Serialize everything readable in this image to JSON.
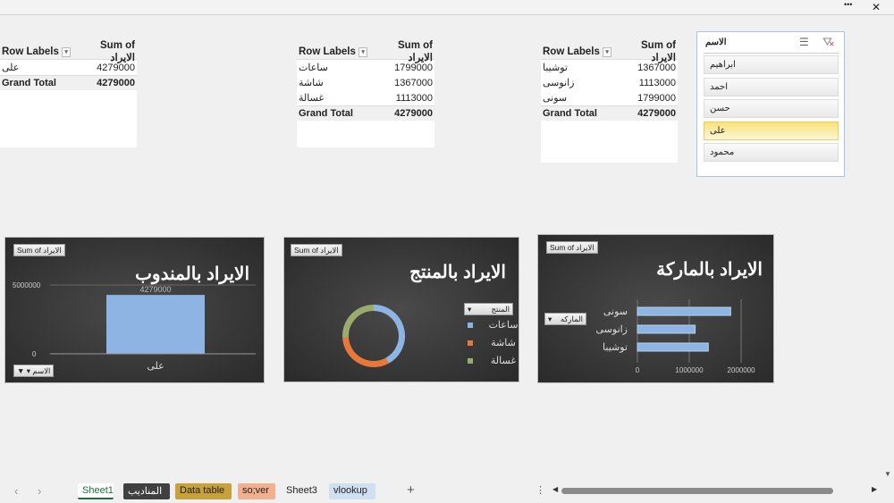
{
  "window": {
    "more_label": "•••",
    "close_label": "✕"
  },
  "pivot1": {
    "header_row": "Row Labels",
    "header_value": "Sum of الايراد",
    "rows": [
      {
        "label": "على",
        "value": "4279000"
      }
    ],
    "total_label": "Grand Total",
    "total_value": "4279000"
  },
  "pivot2": {
    "header_row": "Row Labels",
    "header_value": "Sum of الايراد",
    "rows": [
      {
        "label": "ساعات",
        "value": "1799000"
      },
      {
        "label": "شاشة",
        "value": "1367000"
      },
      {
        "label": "غسالة",
        "value": "1113000"
      }
    ],
    "total_label": "Grand Total",
    "total_value": "4279000"
  },
  "pivot3": {
    "header_row": "Row Labels",
    "header_value": "Sum of الايراد",
    "rows": [
      {
        "label": "توشيبا",
        "value": "1367000"
      },
      {
        "label": "زانوسى",
        "value": "1113000"
      },
      {
        "label": "سونى",
        "value": "1799000"
      }
    ],
    "total_label": "Grand Total",
    "total_value": "4279000"
  },
  "slicer": {
    "title": "الاسم",
    "items": [
      "ابراهيم",
      "احمد",
      "حسن",
      "على",
      "محمود"
    ],
    "selected": "على"
  },
  "chart_data": [
    {
      "type": "bar",
      "title": "الايراد بالمندوب",
      "field_button": "Sum of الايراد",
      "filter_button": "الاسم",
      "categories": [
        "على"
      ],
      "values": [
        4279000
      ],
      "data_labels": [
        "4279000"
      ],
      "yticks": [
        "0",
        "5000000"
      ],
      "ylim": [
        0,
        5000000
      ],
      "color": "#8db4e2"
    },
    {
      "type": "pie",
      "subtype": "doughnut",
      "title": "الايراد بالمنتج",
      "field_button": "Sum of الايراد",
      "legend_button": "المنتج",
      "legend_position": "right",
      "categories": [
        "ساعات",
        "شاشة",
        "غسالة"
      ],
      "values": [
        1799000,
        1367000,
        1113000
      ],
      "colors": [
        "#8db4e2",
        "#e8773a",
        "#9bab6e"
      ]
    },
    {
      "type": "bar",
      "orientation": "horizontal",
      "title": "الايراد بالماركة",
      "field_button": "Sum of الايراد",
      "axis_button": "الماركه",
      "categories": [
        "سونى",
        "زانوسى",
        "توشيبا"
      ],
      "values": [
        1799000,
        1113000,
        1367000
      ],
      "xticks": [
        "0",
        "1000000",
        "2000000"
      ],
      "xlim": [
        0,
        2000000
      ],
      "color": "#8db4e2"
    }
  ],
  "sheet_tabs": [
    {
      "label": "Sheet1",
      "bg": "#ffffff",
      "fg": "#1e6e3c",
      "active": true
    },
    {
      "label": "المناديب",
      "bg": "#404040",
      "fg": "#ffffff"
    },
    {
      "label": "Data table",
      "bg": "#c9a13b",
      "fg": "#222222"
    },
    {
      "label": "so;ver",
      "bg": "#f2b08f",
      "fg": "#222222"
    },
    {
      "label": "Sheet3",
      "bg": "transparent",
      "fg": "#222222"
    },
    {
      "label": "vlookup",
      "bg": "#cfe0f0",
      "fg": "#222222"
    }
  ],
  "add_sheet_label": "+"
}
